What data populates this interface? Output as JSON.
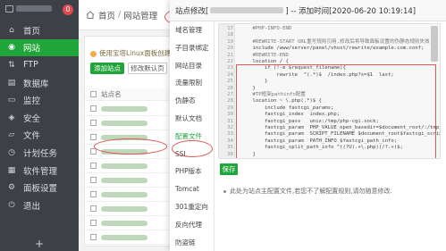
{
  "sidebar": {
    "badge": "0",
    "items": [
      {
        "label": "首页",
        "icon": "home-icon"
      },
      {
        "label": "网站",
        "icon": "globe-icon"
      },
      {
        "label": "FTP",
        "icon": "ftp-icon"
      },
      {
        "label": "数据库",
        "icon": "database-icon"
      },
      {
        "label": "监控",
        "icon": "monitor-icon"
      },
      {
        "label": "安全",
        "icon": "shield-icon"
      },
      {
        "label": "文件",
        "icon": "folder-icon"
      },
      {
        "label": "计划任务",
        "icon": "clock-icon"
      },
      {
        "label": "软件管理",
        "icon": "grid-icon"
      },
      {
        "label": "面板设置",
        "icon": "gear-icon"
      },
      {
        "label": "退出",
        "icon": "logout-icon"
      }
    ],
    "add_label": "+"
  },
  "breadcrumb": {
    "home": "首页",
    "sep": "/",
    "current": "网站管理"
  },
  "page": {
    "warning": "使用宝塔Linux面板创建站点",
    "add_site_button": "添加站点",
    "default_page_button": "修改默认页",
    "table_header_name": "站点名"
  },
  "modal": {
    "title_prefix": "站点修改[",
    "title_suffix": "] -- 添加时间[2020-06-20 10:19:14]",
    "menu": [
      "域名管理",
      "子目录绑定",
      "网站目录",
      "流量限制",
      "伪静态",
      "默认文档",
      "配置文件",
      "SSL",
      "PHP版本",
      "Tomcat",
      "301重定向",
      "反向代理",
      "防盗链"
    ],
    "active_menu_index": 6,
    "code": [
      {
        "n": "17",
        "t": "    #PHP-INFO-END"
      },
      {
        "n": "18",
        "t": ""
      },
      {
        "n": "19",
        "t": "    #REWRITE-START URL重写规则引用,修改后将导致面板设置的伪静态规则失效"
      },
      {
        "n": "20",
        "t": "    include /www/server/panel/vhost/rewrite/example.com.conf;"
      },
      {
        "n": "21",
        "t": "    #REWRITE-END"
      },
      {
        "n": "22",
        "t": "    location / {"
      },
      {
        "n": "23",
        "t": "        if (!-e $request_filename){"
      },
      {
        "n": "24",
        "t": "            rewrite  ^(.*)$  /index.php?s=$1  last;"
      },
      {
        "n": "25",
        "t": "        }"
      },
      {
        "n": "26",
        "t": "    }"
      },
      {
        "n": "27",
        "t": "    #TP框架pathinfo配置"
      },
      {
        "n": "28",
        "t": "    location ~ \\.php(.*)$ {"
      },
      {
        "n": "29",
        "t": "        include fastcgi_params;"
      },
      {
        "n": "30",
        "t": "        fastcgi_index  index.php;"
      },
      {
        "n": "31",
        "t": "        fastcgi_pass   unix:/tmp/php-cgi.sock;"
      },
      {
        "n": "32",
        "t": "        fastcgi_param  PHP_VALUE open_basedir=$document_root/:/tmp/:/proc/;"
      },
      {
        "n": "33",
        "t": "        fastcgi_param  SCRIPT_FILENAME $document_root$fastcgi_script_name;"
      },
      {
        "n": "34",
        "t": "        fastcgi_param  PATH_INFO $fastcgi_path_info;"
      },
      {
        "n": "35",
        "t": "        fastcgi_split_path_info ^((?U).+\\.php)(/?.+)$;"
      },
      {
        "n": "36",
        "t": "    }"
      }
    ],
    "save_button": "保存",
    "note": "此处为站点主配置文件,若您不了解配置规则,请勿随意修改."
  },
  "colors": {
    "accent": "#20a53a",
    "sidebar_bg": "#3d4147",
    "highlight": "#e05a5a"
  }
}
